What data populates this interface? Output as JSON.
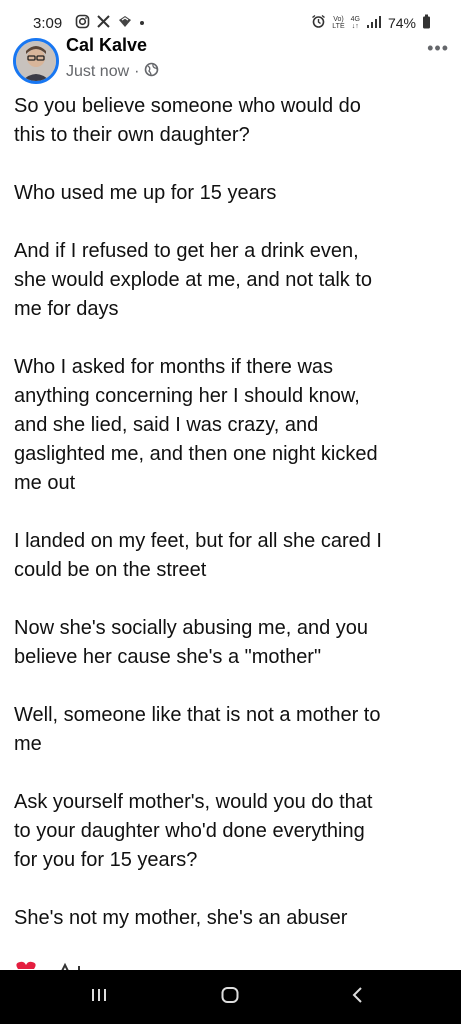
{
  "status": {
    "time": "3:09",
    "network_top": "Vo)",
    "network_bottom": "LTE",
    "signal_top": "4G",
    "signal_bottom": "↓↑",
    "battery": "74%"
  },
  "post": {
    "author": "Cal Kalve",
    "timestamp": "Just now",
    "separator": "·",
    "more_menu": "•••",
    "paragraphs": [
      "So you believe someone who would do\nthis to their own daughter?",
      "Who used me up for 15 years",
      "And if I refused to get her a drink even,\nshe would explode at me, and not talk to\nme for days",
      "Who I asked for months if there was\nanything concerning her I should know,\nand she lied, said I was crazy, and\ngaslighted me, and then one night kicked\nme out",
      "I landed on my feet, but for all she cared I\ncould be on the street",
      "Now she's socially abusing me, and you\nbelieve her cause she's a \"mother\"",
      "Well, someone like that is not a mother to\nme",
      "Ask yourself mother's, would you do that\nto your daughter who'd done everything\nfor you for 15 years?",
      "She's not my mother, she's an abuser"
    ]
  },
  "colors": {
    "accent": "#1877f2",
    "meta_text": "#65676b",
    "reaction_heart": "#e41e3f",
    "nav_bar": "#000000"
  },
  "icons": {
    "status_left": [
      "instagram-icon",
      "x-icon",
      "threads-icon",
      "dot-icon"
    ],
    "status_right": [
      "alarm-icon",
      "signal-bars-icon",
      "battery-icon"
    ],
    "meta": "globe-icon",
    "nav": [
      "recent-apps-icon",
      "home-icon",
      "back-icon"
    ]
  }
}
